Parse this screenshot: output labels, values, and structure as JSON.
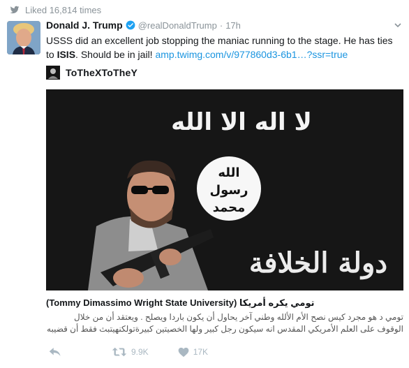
{
  "liked": {
    "text": "Liked 16,814 times",
    "icon": "twitter-bird-icon"
  },
  "tweet": {
    "author_name": "Donald J. Trump",
    "handle": "@realDonaldTrump",
    "separator": "·",
    "time": "17h",
    "text_part1": "USSS did an excellent job stopping the maniac running to the stage. He has ties to ",
    "text_bold": "ISIS",
    "text_part2": ". Should be in jail! ",
    "text_link": "amp.twimg.com/v/977860d3-6b1…?ssr=true",
    "verified_icon": "verified-badge-icon"
  },
  "card": {
    "source_name": "ToTheXToTheY",
    "title": "(Tommy Dimassimo Wright State University) تومي يكره أمريكا",
    "description": "تومي د هو مجرد كيس نصح الأم الألله وطني آخر يحاول أن يكون باردا ويصلح . ويعتقد أن من خلال الوقوف على العلم الأمريكي المقدس انه سيكون رجل كبير ولها الخصيتين كبيرةتولكنهيتبث فقط أن قضيبه",
    "media_text_top": "لا اله الا الله",
    "media_seal_line1": "الله",
    "media_seal_line2": "رسول",
    "media_seal_line3": "محمد",
    "media_text_bottom": "دولة الخلافة"
  },
  "actions": {
    "reply_icon": "reply-icon",
    "retweet_icon": "retweet-icon",
    "retweet_count": "9.9K",
    "like_icon": "heart-icon",
    "like_count": "17K"
  },
  "colors": {
    "link": "#1b95e0",
    "muted": "#8a9399",
    "action": "#aab8c2",
    "verified": "#1da1f2"
  }
}
